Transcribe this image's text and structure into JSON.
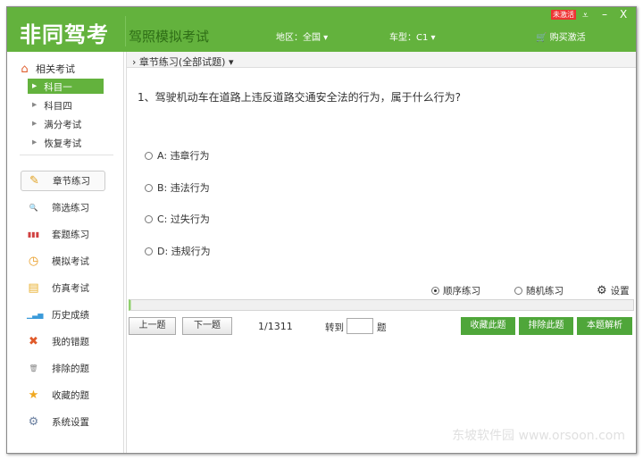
{
  "header": {
    "logo": "非同驾考",
    "subtitle": "驾照模拟考试",
    "region": "地区：全国 ▾",
    "car_type": "车型：C1 ▾",
    "buy": "购买激活",
    "badge": "未激活",
    "menu": "⩡",
    "minimize": "–",
    "close": "X"
  },
  "sidebar": {
    "title": "相关考试",
    "subjects": [
      {
        "label": "科目一"
      },
      {
        "label": "科目四"
      },
      {
        "label": "满分考试"
      },
      {
        "label": "恢复考试"
      }
    ],
    "nav": [
      {
        "label": "章节练习",
        "icon": "✎",
        "color": "#e0a020"
      },
      {
        "label": "筛选练习",
        "icon": "🔍",
        "color": "#4a7fb5"
      },
      {
        "label": "套题练习",
        "icon": "▮▮▮",
        "color": "#d04040"
      },
      {
        "label": "模拟考试",
        "icon": "◷",
        "color": "#e89a20"
      },
      {
        "label": "仿真考试",
        "icon": "▤",
        "color": "#e8b030"
      },
      {
        "label": "历史成绩",
        "icon": "▁▃▅",
        "color": "#3a9ad9"
      },
      {
        "label": "我的错题",
        "icon": "✖",
        "color": "#e05a2a"
      },
      {
        "label": "排除的题",
        "icon": "🗑",
        "color": "#888"
      },
      {
        "label": "收藏的题",
        "icon": "★",
        "color": "#f0a820"
      },
      {
        "label": "系统设置",
        "icon": "⚙",
        "color": "#6a7fa0"
      }
    ]
  },
  "main": {
    "breadcrumb": "› 章节练习(全部试题) ▾",
    "question": "1、驾驶机动车在道路上违反道路交通安全法的行为，属于什么行为?",
    "options": [
      {
        "label": "A: 违章行为"
      },
      {
        "label": "B: 违法行为"
      },
      {
        "label": "C: 过失行为"
      },
      {
        "label": "D: 违规行为"
      }
    ],
    "mode_seq": "顺序练习",
    "mode_rand": "随机练习",
    "settings": "设置",
    "progress": 0.001,
    "prev": "上一题",
    "next": "下一题",
    "counter": "1/1311",
    "goto": "转到",
    "goto_unit": "题",
    "goto_value": "",
    "fav": "收藏此题",
    "exclude": "排除此题",
    "explain": "本题解析"
  },
  "watermark": "东坡软件园 www.orsoon.com"
}
